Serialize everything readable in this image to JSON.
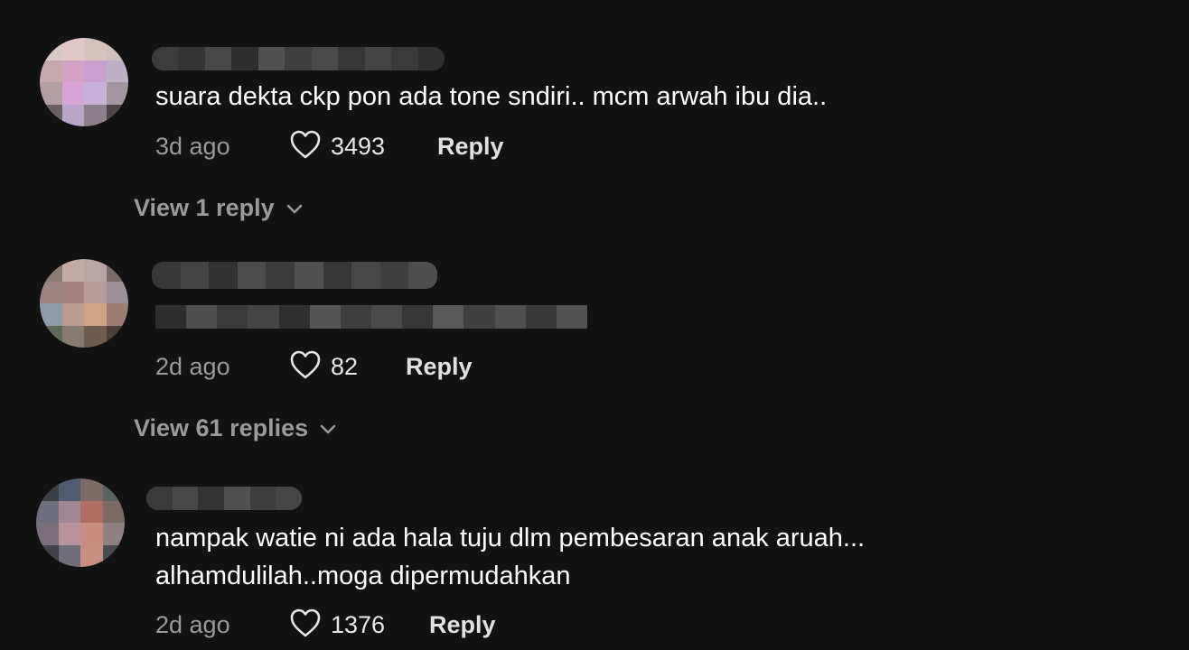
{
  "icons": {
    "like": "heart-outline-icon",
    "expand": "chevron-down-icon"
  },
  "colors": {
    "background": "#121212",
    "secondary_text": "#9a9a9a"
  },
  "comments": [
    {
      "text_lines": [
        "suara dekta ckp pon ada tone sndiri.. mcm arwah ibu dia.."
      ],
      "time": "3d ago",
      "likes": "3493",
      "reply_label": "Reply",
      "view_replies": "View 1 reply"
    },
    {
      "text_lines": [],
      "time": "2d ago",
      "likes": "82",
      "reply_label": "Reply",
      "view_replies": "View 61 replies"
    },
    {
      "text_lines": [
        "nampak watie ni ada hala tuju dlm pembesaran anak aruah...",
        "alhamdulilah..moga dipermudahkan"
      ],
      "time": "2d ago",
      "likes": "1376",
      "reply_label": "Reply"
    }
  ]
}
